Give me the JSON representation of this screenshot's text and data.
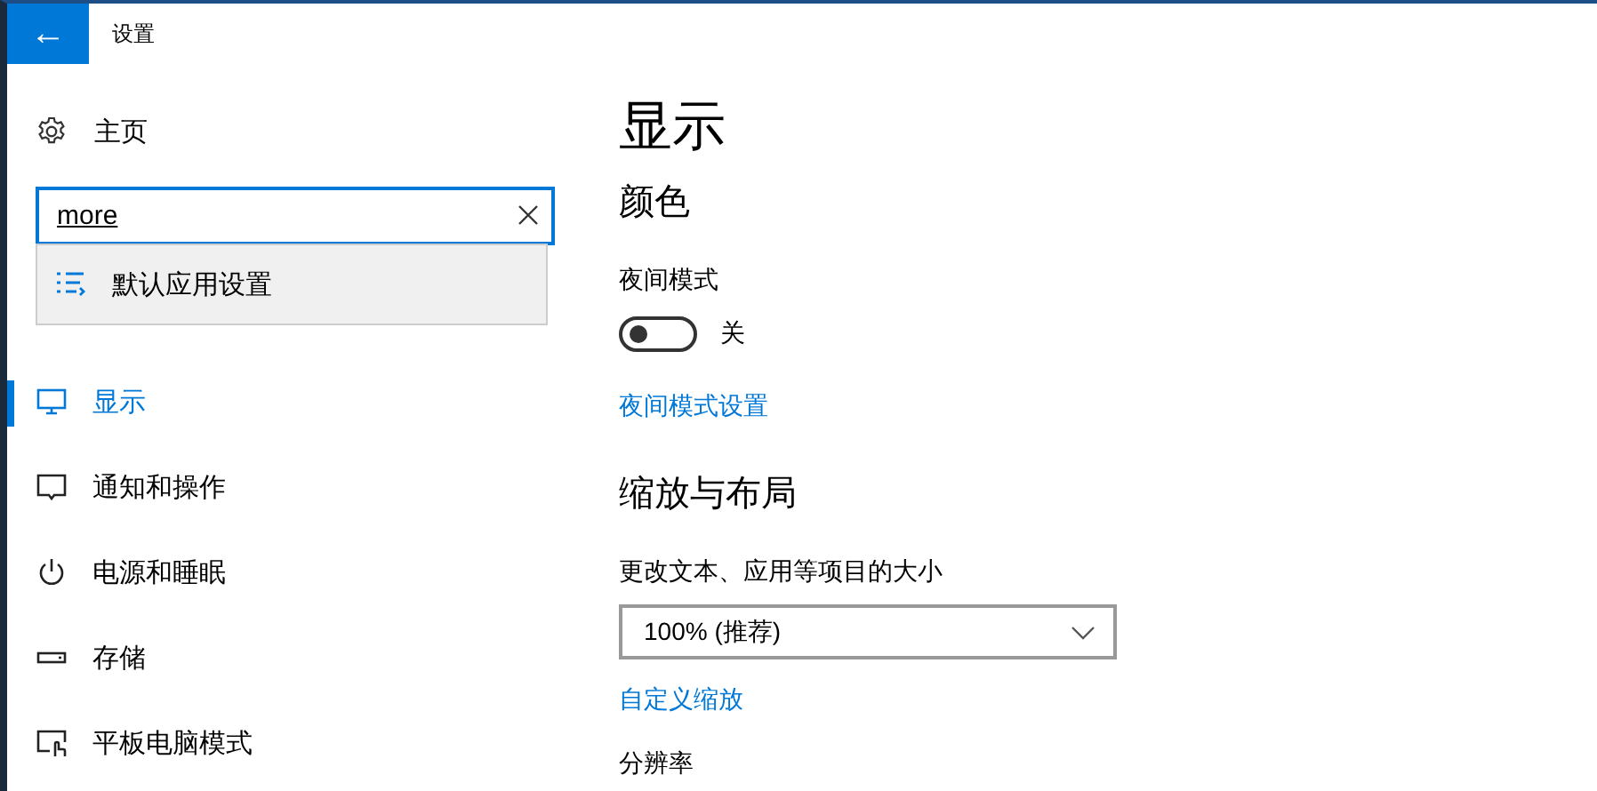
{
  "window": {
    "title": "设置",
    "back": "←"
  },
  "sidebar": {
    "home": "主页",
    "search": {
      "value": "more"
    },
    "suggestions": [
      {
        "label": "默认应用设置"
      }
    ],
    "items": [
      {
        "label": "显示",
        "selected": true
      },
      {
        "label": "通知和操作",
        "selected": false
      },
      {
        "label": "电源和睡眠",
        "selected": false
      },
      {
        "label": "存储",
        "selected": false
      },
      {
        "label": "平板电脑模式",
        "selected": false
      }
    ]
  },
  "content": {
    "title": "显示",
    "sections": [
      {
        "heading": "颜色",
        "controls": [
          {
            "kind": "toggle",
            "label": "夜间模式",
            "on": false,
            "state": "关"
          },
          {
            "kind": "link",
            "label": "夜间模式设置"
          }
        ]
      },
      {
        "heading": "缩放与布局",
        "controls": [
          {
            "kind": "dropdown",
            "label": "更改文本、应用等项目的大小",
            "value": "100% (推荐)"
          },
          {
            "kind": "link",
            "label": "自定义缩放"
          },
          {
            "kind": "label",
            "label": "分辨率"
          }
        ]
      }
    ]
  }
}
